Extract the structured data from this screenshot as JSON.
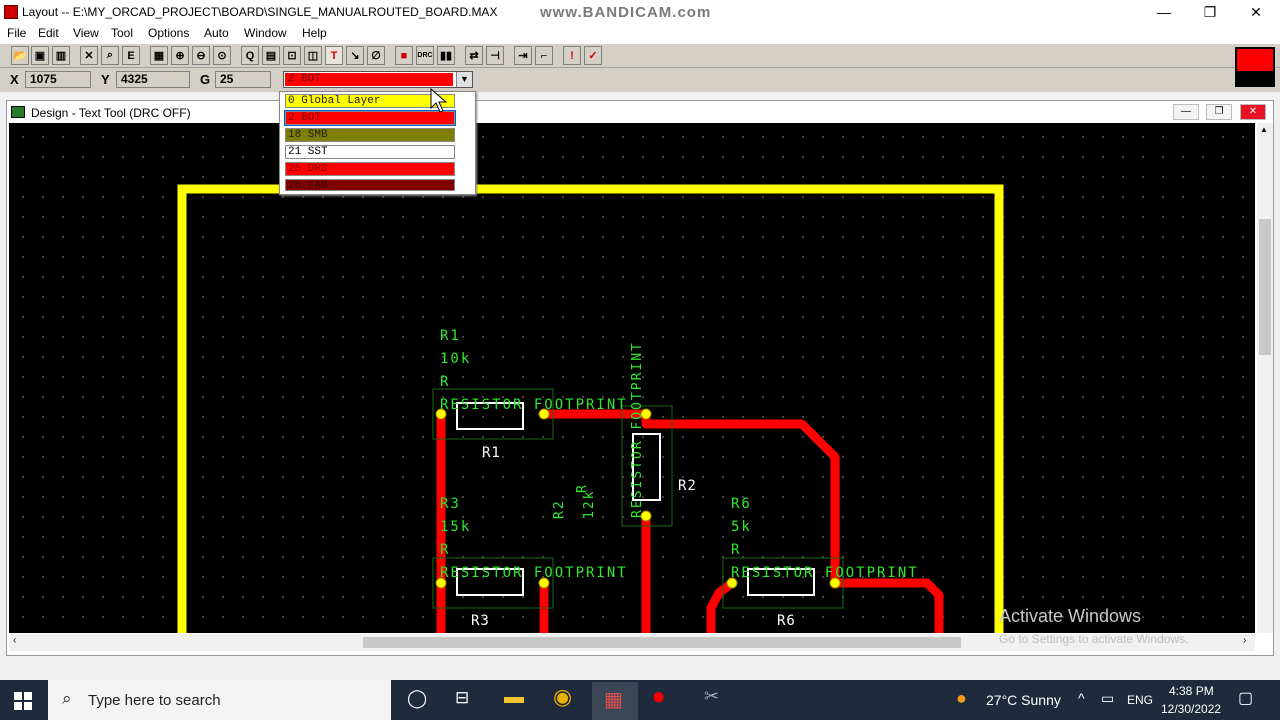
{
  "window": {
    "title": "Layout -- E:\\MY_ORCAD_PROJECT\\BOARD\\SINGLE_MANUALROUTED_BOARD.MAX",
    "watermark": "www.BANDICAM.com",
    "minimize": "—",
    "restore": "❐",
    "close": "✕"
  },
  "menu": [
    "File",
    "Edit",
    "View",
    "Tool",
    "Options",
    "Auto",
    "Window",
    "Help"
  ],
  "status": {
    "x_label": "X",
    "x_value": "1075",
    "y_label": "Y",
    "y_value": "4325",
    "g_label": "G",
    "g_value": "25",
    "current_layer": "2 BOT"
  },
  "layer_dropdown": {
    "options": [
      {
        "label": "0 Global Layer",
        "color": "#ffff00",
        "text_color": "#202000"
      },
      {
        "label": "2 BOT",
        "color": "#ff0000",
        "text_color": "#800000"
      },
      {
        "label": "18 SMB",
        "color": "#808000",
        "text_color": "#202000"
      },
      {
        "label": "21 SST",
        "color": "#ffffff",
        "text_color": "#000000"
      },
      {
        "label": "25 DRD",
        "color": "#ff0000",
        "text_color": "#800000"
      },
      {
        "label": "26 FAB",
        "color": "#800000",
        "text_color": "#400000"
      }
    ]
  },
  "design_window": {
    "title": "Design - Text Tool (DRC OFF)",
    "minimize": "—",
    "restore": "❐",
    "close": "✕"
  },
  "board": {
    "outline_color": "#ffff00",
    "trace_color": "#ff0000",
    "silkscreen_color": "#33ee33",
    "components": {
      "r1": {
        "ref": "R1",
        "value": "10k",
        "type": "R",
        "footprint": "RESISTOR FOOTPRINT",
        "label": "R1"
      },
      "r2": {
        "ref": "R2",
        "value": "12k",
        "type": "R",
        "footprint": "RESISTOR FOOTPRINT",
        "label": "R2"
      },
      "r3": {
        "ref": "R3",
        "value": "15k",
        "type": "R",
        "footprint": "RESISTOR FOOTPRINT",
        "label": "R3"
      },
      "r6": {
        "ref": "R6",
        "value": "5k",
        "type": "R",
        "footprint": "RESISTOR FOOTPRINT",
        "label": "R6"
      }
    }
  },
  "activation": {
    "line1": "Activate Windows",
    "line2": "Go to Settings to activate Windows."
  },
  "taskbar": {
    "search_placeholder": "Type here to search",
    "weather": "27°C  Sunny",
    "language": "ENG",
    "time": "4:38 PM",
    "date": "12/30/2022"
  }
}
